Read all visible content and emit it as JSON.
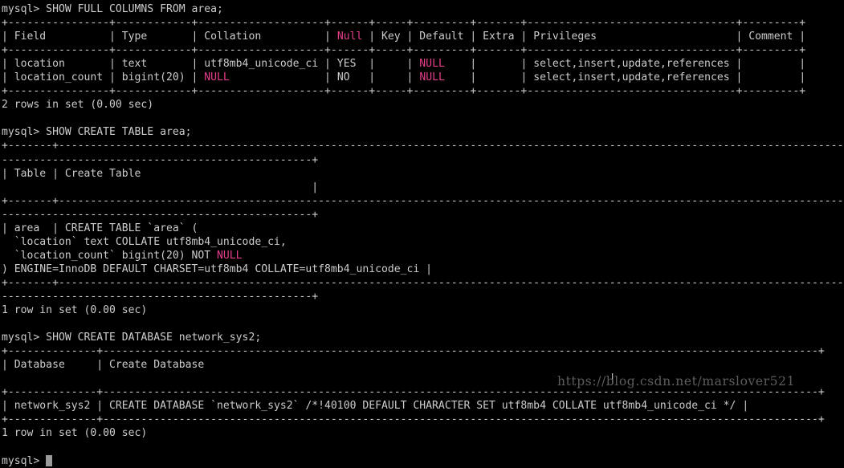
{
  "terminal": {
    "title": "mysql client terminal",
    "prompt": "mysql> ",
    "background_color": "#000000",
    "foreground_color": "#cfcfcf",
    "magenta_color": "#e83e8c",
    "watermark": "https://blog.csdn.net/marslover521",
    "cursor": "block"
  },
  "commands": [
    "SHOW FULL COLUMNS FROM area;",
    "SHOW CREATE TABLE area;",
    "SHOW CREATE DATABASE network_sys2;"
  ],
  "lines": [
    {
      "id": "l01",
      "type": "command",
      "text": "mysql> SHOW FULL COLUMNS FROM area;"
    },
    {
      "id": "l02",
      "type": "rule",
      "text": "+----------------+------------+--------------------+------+-----+---------+-------+---------------------------------+---------+"
    },
    {
      "id": "l03",
      "type": "header",
      "text": "| Field          | Type       | Collation          | Null | Key | Default | Extra | Privileges                      | Comment |",
      "magenta": [
        "Null"
      ]
    },
    {
      "id": "l04",
      "type": "rule",
      "text": "+----------------+------------+--------------------+------+-----+---------+-------+---------------------------------+---------+"
    },
    {
      "id": "l05",
      "type": "row",
      "text": "| location       | text       | utf8mb4_unicode_ci | YES  |     | NULL    |       | select,insert,update,references |         |",
      "magenta": [
        "NULL"
      ]
    },
    {
      "id": "l06",
      "type": "row",
      "text": "| location_count | bigint(20) | NULL               | NO   |     | NULL    |       | select,insert,update,references |         |",
      "magenta": [
        "NULL"
      ]
    },
    {
      "id": "l07",
      "type": "rule",
      "text": "+----------------+------------+--------------------+------+-----+---------+-------+---------------------------------+---------+"
    },
    {
      "id": "l08",
      "type": "status",
      "text": "2 rows in set (0.00 sec)"
    },
    {
      "id": "l09",
      "type": "blank",
      "text": ""
    },
    {
      "id": "l10",
      "type": "command",
      "text": "mysql> SHOW CREATE TABLE area;"
    },
    {
      "id": "l11",
      "type": "rule",
      "text": "+-------+-------------------------------------------------------------------------------------------------------------------------------------"
    },
    {
      "id": "l12",
      "type": "rule",
      "text": "-------------------------------------------------+"
    },
    {
      "id": "l13",
      "type": "header",
      "text": "| Table | Create Table"
    },
    {
      "id": "l14",
      "type": "cont",
      "text": "                                                 |"
    },
    {
      "id": "l15",
      "type": "rule",
      "text": "+-------+-------------------------------------------------------------------------------------------------------------------------------------"
    },
    {
      "id": "l16",
      "type": "rule",
      "text": "-------------------------------------------------+"
    },
    {
      "id": "l17",
      "type": "row",
      "text": "| area  | CREATE TABLE `area` ("
    },
    {
      "id": "l18",
      "type": "row",
      "text": "  `location` text COLLATE utf8mb4_unicode_ci,"
    },
    {
      "id": "l19",
      "type": "row",
      "text": "  `location_count` bigint(20) NOT NULL",
      "magenta": [
        "NULL"
      ]
    },
    {
      "id": "l20",
      "type": "row",
      "text": ") ENGINE=InnoDB DEFAULT CHARSET=utf8mb4 COLLATE=utf8mb4_unicode_ci |"
    },
    {
      "id": "l21",
      "type": "rule",
      "text": "+-------+-------------------------------------------------------------------------------------------------------------------------------------"
    },
    {
      "id": "l22",
      "type": "rule",
      "text": "-------------------------------------------------+"
    },
    {
      "id": "l23",
      "type": "status",
      "text": "1 row in set (0.00 sec)"
    },
    {
      "id": "l24",
      "type": "blank",
      "text": ""
    },
    {
      "id": "l25",
      "type": "command",
      "text": "mysql> SHOW CREATE DATABASE network_sys2;"
    },
    {
      "id": "l26",
      "type": "rule",
      "text": "+--------------+-----------------------------------------------------------------------------------------------------------------+"
    },
    {
      "id": "l27",
      "type": "header",
      "text": "| Database     | Create Database"
    },
    {
      "id": "l28",
      "type": "cont",
      "text": "                                                                                                |"
    },
    {
      "id": "l29",
      "type": "rule",
      "text": "+--------------+-----------------------------------------------------------------------------------------------------------------+"
    },
    {
      "id": "l30",
      "type": "row",
      "text": "| network_sys2 | CREATE DATABASE `network_sys2` /*!40100 DEFAULT CHARACTER SET utf8mb4 COLLATE utf8mb4_unicode_ci */ |"
    },
    {
      "id": "l31",
      "type": "rule",
      "text": "+--------------+-----------------------------------------------------------------------------------------------------------------+"
    },
    {
      "id": "l32",
      "type": "status",
      "text": "1 row in set (0.00 sec)"
    },
    {
      "id": "l33",
      "type": "blank",
      "text": ""
    },
    {
      "id": "l34",
      "type": "prompt",
      "text": "mysql> "
    }
  ],
  "tables": {
    "show_full_columns": {
      "columns": [
        "Field",
        "Type",
        "Collation",
        "Null",
        "Key",
        "Default",
        "Extra",
        "Privileges",
        "Comment"
      ],
      "rows": [
        [
          "location",
          "text",
          "utf8mb4_unicode_ci",
          "YES",
          "",
          "NULL",
          "",
          "select,insert,update,references",
          ""
        ],
        [
          "location_count",
          "bigint(20)",
          "NULL",
          "NO",
          "",
          "NULL",
          "",
          "select,insert,update,references",
          ""
        ]
      ],
      "result": "2 rows in set (0.00 sec)"
    },
    "show_create_table": {
      "columns": [
        "Table",
        "Create Table"
      ],
      "rows": [
        [
          "area",
          "CREATE TABLE `area` (\n  `location` text COLLATE utf8mb4_unicode_ci,\n  `location_count` bigint(20) NOT NULL\n) ENGINE=InnoDB DEFAULT CHARSET=utf8mb4 COLLATE=utf8mb4_unicode_ci"
        ]
      ],
      "result": "1 row in set (0.00 sec)"
    },
    "show_create_database": {
      "columns": [
        "Database",
        "Create Database"
      ],
      "rows": [
        [
          "network_sys2",
          "CREATE DATABASE `network_sys2` /*!40100 DEFAULT CHARACTER SET utf8mb4 COLLATE utf8mb4_unicode_ci */"
        ]
      ],
      "result": "1 row in set (0.00 sec)"
    }
  }
}
